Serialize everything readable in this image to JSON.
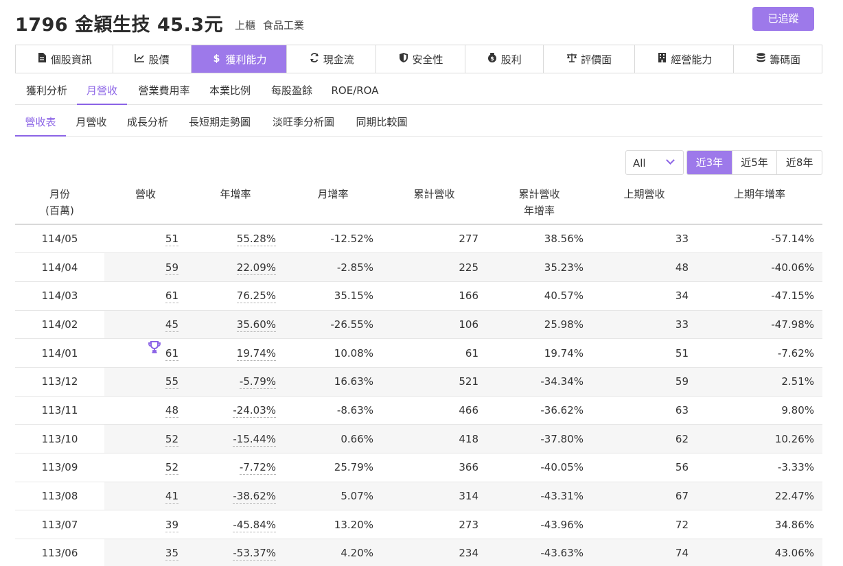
{
  "stock": {
    "title": "1796 金穎生技 45.3元",
    "market": "上櫃",
    "industry": "食品工業",
    "track_label": "已追蹤"
  },
  "main_tabs": [
    {
      "label": "個股資訊",
      "icon": "document-icon"
    },
    {
      "label": "股價",
      "icon": "line-chart-icon"
    },
    {
      "label": "獲利能力",
      "icon": "dollar-icon",
      "active": true
    },
    {
      "label": "現金流",
      "icon": "refresh-icon"
    },
    {
      "label": "安全性",
      "icon": "shield-icon"
    },
    {
      "label": "股利",
      "icon": "money-bag-icon"
    },
    {
      "label": "評價面",
      "icon": "balance-scale-icon"
    },
    {
      "label": "經營能力",
      "icon": "building-icon"
    },
    {
      "label": "籌碼面",
      "icon": "database-icon"
    }
  ],
  "sub_tabs": [
    "獲利分析",
    "月營收",
    "營業費用率",
    "本業比例",
    "每股盈餘",
    "ROE/ROA"
  ],
  "sub_tabs_active": "月營收",
  "sub_tabs2": [
    "營收表",
    "月營收",
    "成長分析",
    "長短期走勢圖",
    "淡旺季分析圖",
    "同期比較圖"
  ],
  "sub_tabs2_active": "營收表",
  "filter": {
    "select_value": "All",
    "ranges": [
      "近3年",
      "近5年",
      "近8年"
    ],
    "active_range": "近3年"
  },
  "table": {
    "headers": [
      {
        "line1": "月份",
        "line2": "(百萬)"
      },
      {
        "line1": "營收",
        "line2": ""
      },
      {
        "line1": "年增率",
        "line2": ""
      },
      {
        "line1": "月增率",
        "line2": ""
      },
      {
        "line1": "累計營收",
        "line2": ""
      },
      {
        "line1": "累計營收",
        "line2": "年增率"
      },
      {
        "line1": "上期營收",
        "line2": ""
      },
      {
        "line1": "上期年增率",
        "line2": ""
      }
    ],
    "rows": [
      {
        "month": "114/05",
        "revenue": "51",
        "yoy": "55.28%",
        "mom": "-12.52%",
        "cum": "277",
        "cum_yoy": "38.56%",
        "prev": "33",
        "prev_yoy": "-57.14%"
      },
      {
        "month": "114/04",
        "revenue": "59",
        "yoy": "22.09%",
        "mom": "-2.85%",
        "cum": "225",
        "cum_yoy": "35.23%",
        "prev": "48",
        "prev_yoy": "-40.06%"
      },
      {
        "month": "114/03",
        "revenue": "61",
        "yoy": "76.25%",
        "mom": "35.15%",
        "cum": "166",
        "cum_yoy": "40.57%",
        "prev": "34",
        "prev_yoy": "-47.15%"
      },
      {
        "month": "114/02",
        "revenue": "45",
        "yoy": "35.60%",
        "mom": "-26.55%",
        "cum": "106",
        "cum_yoy": "25.98%",
        "prev": "33",
        "prev_yoy": "-47.98%"
      },
      {
        "month": "114/01",
        "revenue": "61",
        "yoy": "19.74%",
        "mom": "10.08%",
        "cum": "61",
        "cum_yoy": "19.74%",
        "prev": "51",
        "prev_yoy": "-7.62%",
        "trophy": true
      },
      {
        "month": "113/12",
        "revenue": "55",
        "yoy": "-5.79%",
        "mom": "16.63%",
        "cum": "521",
        "cum_yoy": "-34.34%",
        "prev": "59",
        "prev_yoy": "2.51%"
      },
      {
        "month": "113/11",
        "revenue": "48",
        "yoy": "-24.03%",
        "mom": "-8.63%",
        "cum": "466",
        "cum_yoy": "-36.62%",
        "prev": "63",
        "prev_yoy": "9.80%"
      },
      {
        "month": "113/10",
        "revenue": "52",
        "yoy": "-15.44%",
        "mom": "0.66%",
        "cum": "418",
        "cum_yoy": "-37.80%",
        "prev": "62",
        "prev_yoy": "10.26%"
      },
      {
        "month": "113/09",
        "revenue": "52",
        "yoy": "-7.72%",
        "mom": "25.79%",
        "cum": "366",
        "cum_yoy": "-40.05%",
        "prev": "56",
        "prev_yoy": "-3.33%"
      },
      {
        "month": "113/08",
        "revenue": "41",
        "yoy": "-38.62%",
        "mom": "5.07%",
        "cum": "314",
        "cum_yoy": "-43.31%",
        "prev": "67",
        "prev_yoy": "22.47%"
      },
      {
        "month": "113/07",
        "revenue": "39",
        "yoy": "-45.84%",
        "mom": "13.20%",
        "cum": "273",
        "cum_yoy": "-43.96%",
        "prev": "72",
        "prev_yoy": "34.86%"
      },
      {
        "month": "113/06",
        "revenue": "35",
        "yoy": "-53.37%",
        "mom": "4.20%",
        "cum": "234",
        "cum_yoy": "-43.63%",
        "prev": "74",
        "prev_yoy": "43.06%"
      }
    ]
  },
  "colors": {
    "accent": "#9d79ea",
    "accent_text": "#8b63e6",
    "negative": "#e0395a"
  }
}
